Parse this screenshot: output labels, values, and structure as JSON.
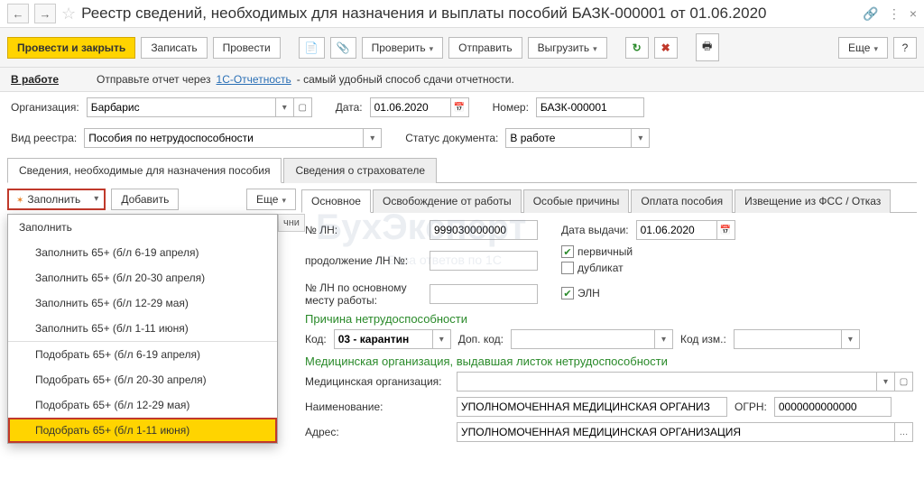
{
  "title": "Реестр сведений, необходимых для назначения и выплаты пособий БАЗК-000001 от 01.06.2020",
  "toolbar": {
    "post_close": "Провести и закрыть",
    "save": "Записать",
    "post": "Провести",
    "verify": "Проверить",
    "send": "Отправить",
    "export": "Выгрузить",
    "more": "Еще"
  },
  "info": {
    "status": "В работе",
    "hint_prefix": "Отправьте отчет через ",
    "hint_link": "1С-Отчетность",
    "hint_suffix": " - самый удобный способ сдачи отчетности."
  },
  "fields": {
    "org_label": "Организация:",
    "org_value": "Барбарис",
    "date_label": "Дата:",
    "date_value": "01.06.2020",
    "number_label": "Номер:",
    "number_value": "БАЗК-000001",
    "type_label": "Вид реестра:",
    "type_value": "Пособия по нетрудоспособности",
    "status_label": "Статус документа:",
    "status_value": "В работе"
  },
  "main_tabs": {
    "t1": "Сведения, необходимые для назначения пособия",
    "t2": "Сведения о страхователе"
  },
  "left": {
    "fill": "Заполнить",
    "add": "Добавить",
    "more": "Еще",
    "col_truncated": "чни",
    "menu": {
      "m0": "Заполнить",
      "m1": "Заполнить 65+ (б/л 6-19 апреля)",
      "m2": "Заполнить 65+ (б/л 20-30 апреля)",
      "m3": "Заполнить 65+ (б/л 12-29 мая)",
      "m4": "Заполнить 65+ (б/л 1-11 июня)",
      "m5": "Подобрать 65+ (б/л 6-19 апреля)",
      "m6": "Подобрать 65+ (б/л 20-30 апреля)",
      "m7": "Подобрать 65+ (б/л 12-29 мая)",
      "m8": "Подобрать 65+ (б/л 1-11 июня)"
    }
  },
  "inner_tabs": {
    "t1": "Основное",
    "t2": "Освобождение от работы",
    "t3": "Особые причины",
    "t4": "Оплата пособия",
    "t5": "Извещение из ФСС / Отказ"
  },
  "panel": {
    "ln_label": "№ ЛН:",
    "ln_value": "999030000000",
    "issue_date_label": "Дата выдачи:",
    "issue_date_value": "01.06.2020",
    "ln_cont_label": "продолжение ЛН №:",
    "chk_primary": "первичный",
    "chk_duplicate": "дубликат",
    "chk_eln": "ЭЛН",
    "ln_main_label": "№ ЛН по основному месту работы:",
    "reason_title": "Причина нетрудоспособности",
    "code_label": "Код:",
    "code_value": "03 - карантин",
    "addcode_label": "Доп. код:",
    "code_change_label": "Код изм.:",
    "medorg_title": "Медицинская организация, выдавшая листок нетрудоспособности",
    "medorg_label": "Медицинская организация:",
    "name_label": "Наименование:",
    "name_value": "УПОЛНОМОЧЕННАЯ МЕДИЦИНСКАЯ ОРГАНИЗ",
    "ogrn_label": "ОГРН:",
    "ogrn_value": "0000000000000",
    "address_label": "Адрес:",
    "address_value": "УПОЛНОМОЧЕННАЯ МЕДИЦИНСКАЯ ОРГАНИЗАЦИЯ"
  },
  "watermark": {
    "main": "БухЭксперт",
    "sub": "База ответов по 1С"
  }
}
